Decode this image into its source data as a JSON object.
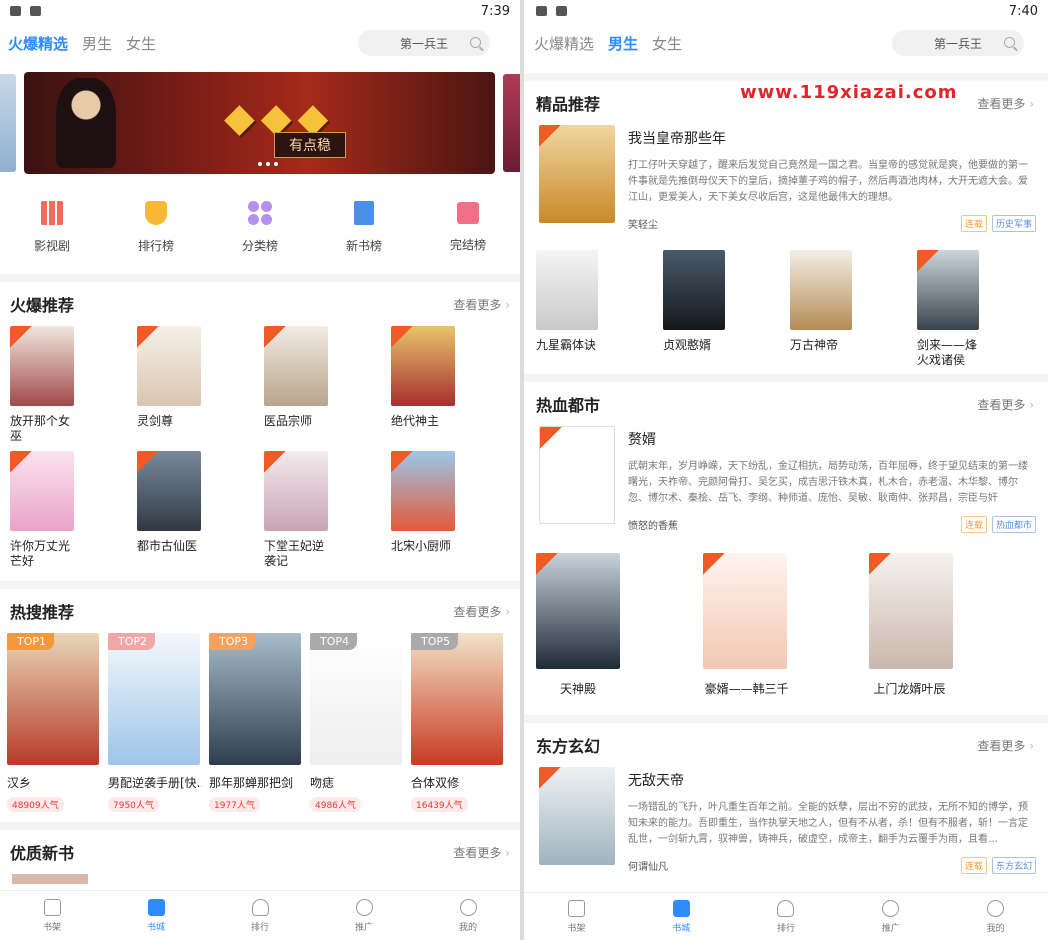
{
  "left": {
    "status_time": "7:39",
    "tabs": [
      "火爆精选",
      "男生",
      "女生"
    ],
    "search_placeholder": "第一兵王",
    "banner_text": "有点稳",
    "categories": [
      "影视剧",
      "排行榜",
      "分类榜",
      "新书榜",
      "完结榜"
    ],
    "section1": {
      "title": "火爆推荐",
      "more": "查看更多",
      "books": [
        "放开那个女巫",
        "灵剑尊",
        "医品宗师",
        "绝代神主",
        "许你万丈光芒好",
        "都市古仙医",
        "下堂王妃逆袭记",
        "北宋小厨师"
      ]
    },
    "section2": {
      "title": "热搜推荐",
      "more": "查看更多",
      "books": [
        {
          "rank": "TOP1",
          "name": "汉乡",
          "pop": "48909人气"
        },
        {
          "rank": "TOP2",
          "name": "男配逆袭手册[快...",
          "pop": "7950人气"
        },
        {
          "rank": "TOP3",
          "name": "那年那蝉那把剑",
          "pop": "1977人气"
        },
        {
          "rank": "TOP4",
          "name": "吻痣",
          "pop": "4986人气"
        },
        {
          "rank": "TOP5",
          "name": "合体双修",
          "pop": "16439人气"
        }
      ]
    },
    "section3": {
      "title": "优质新书",
      "more": "查看更多"
    },
    "tabbar": [
      "书架",
      "书城",
      "排行",
      "推广",
      "我的"
    ]
  },
  "right": {
    "status_time": "7:40",
    "tabs": [
      "火爆精选",
      "男生",
      "女生"
    ],
    "search_placeholder": "第一兵王",
    "watermark": "www.119xiazai.com",
    "section1": {
      "title": "精品推荐",
      "more": "查看更多",
      "featured": {
        "name": "我当皇帝那些年",
        "desc": "打工仔叶天穿越了，醒来后发觉自己竟然是一国之君。当皇帝的感觉就是爽，他要做的第一件事就是先推倒母仪天下的皇后，摘掉董子鸡的帽子，然后再酒池肉林，大开无遮大会。爱江山，更爱美人，天下美女尽收后宫，这是他最伟大的理想。",
        "author": "笑轻尘",
        "status": "连载",
        "genre": "历史军事"
      },
      "books": [
        "九星霸体诀",
        "贞观憨婿",
        "万古神帝",
        "剑来——烽火戏诸侯"
      ]
    },
    "section2": {
      "title": "热血都市",
      "more": "查看更多",
      "featured": {
        "name": "赘婿",
        "desc": "武朝末年，岁月峥嵘，天下纷乱，金辽相抗，局势动荡，百年屈辱，终于望见结束的第一缕曙光，天祚帝、完颜阿骨打、吴乞买，成吉思汗铁木真，札木合，赤老温、木华黎、博尔忽、博尔术、秦桧、岳飞、李纲、种师道、庞怡、吴敏、耿南仲、张邦昌，宗臣与奸",
        "author": "愤怒的香蕉",
        "status": "连载",
        "genre": "热血都市"
      },
      "books": [
        "天神殿",
        "豪婿——韩三千",
        "上门龙婿叶辰"
      ]
    },
    "section3": {
      "title": "东方玄幻",
      "more": "查看更多",
      "featured": {
        "name": "无敌天帝",
        "desc": "一场错乱的飞升，叶凡重生百年之前。全能的妖孽，层出不穷的武技，无所不知的博学，预知未来的能力。吾即重生，当作执掌天地之人，但有不从者，杀！但有不服者，斩！一言定乱世，一剑斩九霄，驭神兽，铸神兵，破虚空，成帝主，翻手为云覆手为雨，且看…",
        "author": "何谓仙凡",
        "status": "连载",
        "genre": "东方玄幻"
      }
    },
    "tabbar": [
      "书架",
      "书城",
      "排行",
      "推广",
      "我的"
    ]
  },
  "colors": {
    "accent": "#2f8cff",
    "hot": "#e83a3a",
    "tag": "#f05a24",
    "top1": "#f39a37",
    "top2": "#f0a7a7",
    "top3": "#f4a261",
    "top4": "#aaaaaa"
  }
}
